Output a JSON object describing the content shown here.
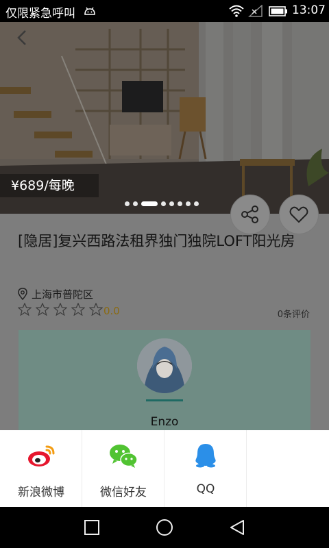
{
  "status_bar": {
    "carrier": "仅限紧急呼叫",
    "time": "13:07"
  },
  "listing": {
    "price": "¥689/每晚",
    "title": "[隐居]复兴西路法租界独门独院LOFT阳光房",
    "location": "上海市普陀区",
    "rating": "0.0",
    "review_count": "0条评价",
    "photo_count": 8,
    "active_photo": 2,
    "stars_total": 5,
    "stars_filled": 0
  },
  "host": {
    "name": "Enzo"
  },
  "share_sheet": {
    "items": [
      {
        "label": "新浪微博",
        "icon": "weibo-icon",
        "color": "#e6162d"
      },
      {
        "label": "微信好友",
        "icon": "wechat-icon",
        "color": "#51c332"
      },
      {
        "label": "QQ",
        "icon": "qq-icon",
        "color": "#2b8fe8"
      }
    ]
  },
  "colors": {
    "overlay": "#7d7d7d",
    "host_card": "#6f8c84",
    "rating": "#8a6a12"
  },
  "icons": [
    "android-debug-icon",
    "wifi-icon",
    "signal-icon",
    "battery-icon",
    "back-arrow-icon",
    "share-icon",
    "heart-icon",
    "location-pin-icon",
    "star-icon",
    "square-recents-icon",
    "circle-home-icon",
    "triangle-back-icon"
  ]
}
